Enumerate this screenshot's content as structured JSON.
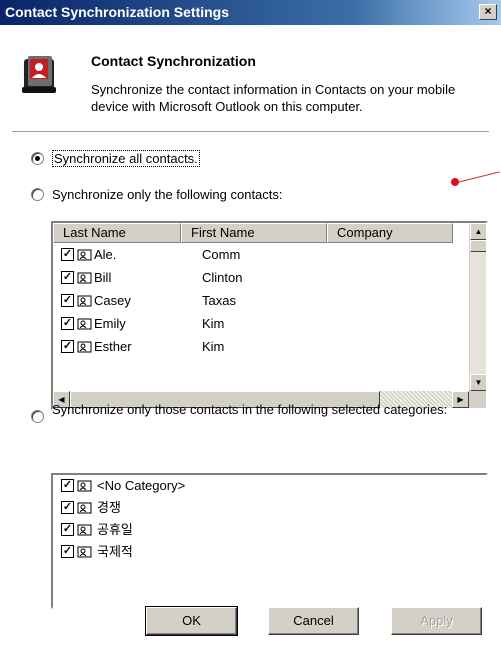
{
  "window": {
    "title": "Contact Synchronization Settings",
    "close_glyph": "×"
  },
  "header": {
    "title": "Contact Synchronization",
    "description": "Synchronize the contact information in Contacts on your mobile device with Microsoft Outlook on this computer.",
    "icon": "address-book-icon"
  },
  "options": {
    "all_contacts": {
      "label": "Synchronize all contacts.",
      "checked": true
    },
    "only_following": {
      "label": "Synchronize only the following contacts:",
      "checked": false
    },
    "only_categories": {
      "label": "Synchronize only those contacts in the following selected categories:",
      "checked": false
    }
  },
  "contacts_table": {
    "columns": [
      "Last Name",
      "First Name",
      "Company"
    ],
    "rows": [
      {
        "last": "Ale.",
        "first": "Comm",
        "company": "",
        "checked": true
      },
      {
        "last": "Bill",
        "first": "Clinton",
        "company": "",
        "checked": true
      },
      {
        "last": "Casey",
        "first": "Taxas",
        "company": "",
        "checked": true
      },
      {
        "last": "Emily",
        "first": "Kim",
        "company": "",
        "checked": true
      },
      {
        "last": "Esther",
        "first": "Kim",
        "company": "",
        "checked": true
      }
    ]
  },
  "categories": [
    {
      "label": "<No Category>",
      "checked": true
    },
    {
      "label": "경쟁",
      "checked": true
    },
    {
      "label": "공휴일",
      "checked": true
    },
    {
      "label": "국제적",
      "checked": true
    }
  ],
  "buttons": {
    "ok": "OK",
    "cancel": "Cancel",
    "apply": "Apply"
  },
  "colors": {
    "titlebar": "#0a246a",
    "annotation": "#e0101a"
  }
}
